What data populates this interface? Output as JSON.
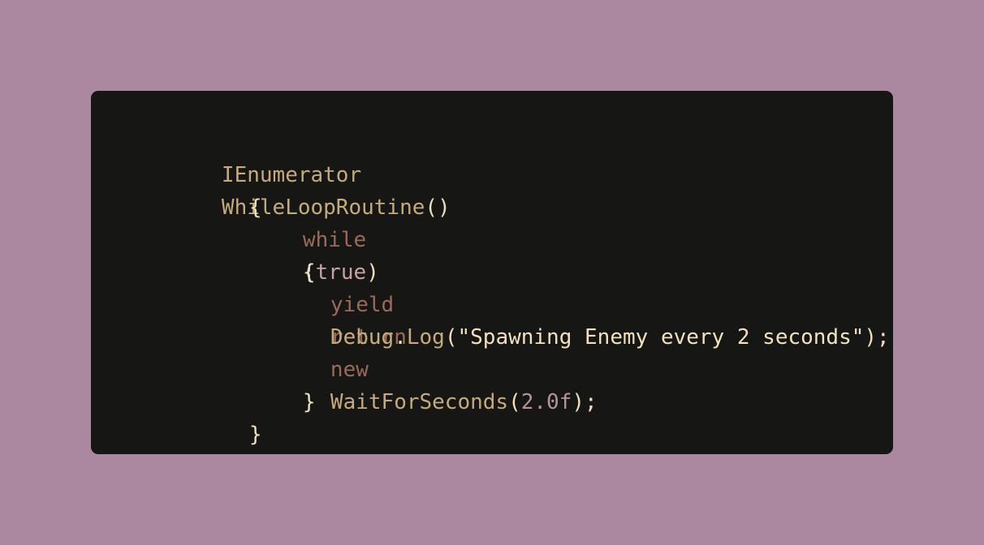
{
  "code": {
    "line1": {
      "type": "IEnumerator",
      "name": "WhileLoopRoutine",
      "parens": "()"
    },
    "line2": {
      "brace": "{"
    },
    "line3": {
      "keyword": "while",
      "open": "(",
      "literal": "true",
      "close": ")"
    },
    "line4": {
      "brace": "{"
    },
    "line5": {
      "yield": "yield",
      "return": "return",
      "new": "new",
      "class": "WaitForSeconds",
      "open": "(",
      "number": "2.0f",
      "close": ");"
    },
    "line6": {
      "object": "Debug",
      "dot": ".",
      "method": "Log",
      "open": "(",
      "string": "\"Spawning Enemy every 2 seconds\"",
      "close": ");"
    },
    "line8": {
      "brace": "}"
    },
    "line9": {
      "brace": "}"
    }
  },
  "colors": {
    "background": "#ab889f",
    "card": "#161614",
    "identifier": "#c4aa7c",
    "keyword": "#9a6a58",
    "literal": "#c9a2a6",
    "string": "#f2e0bf",
    "punctuation": "#eedfc1"
  }
}
